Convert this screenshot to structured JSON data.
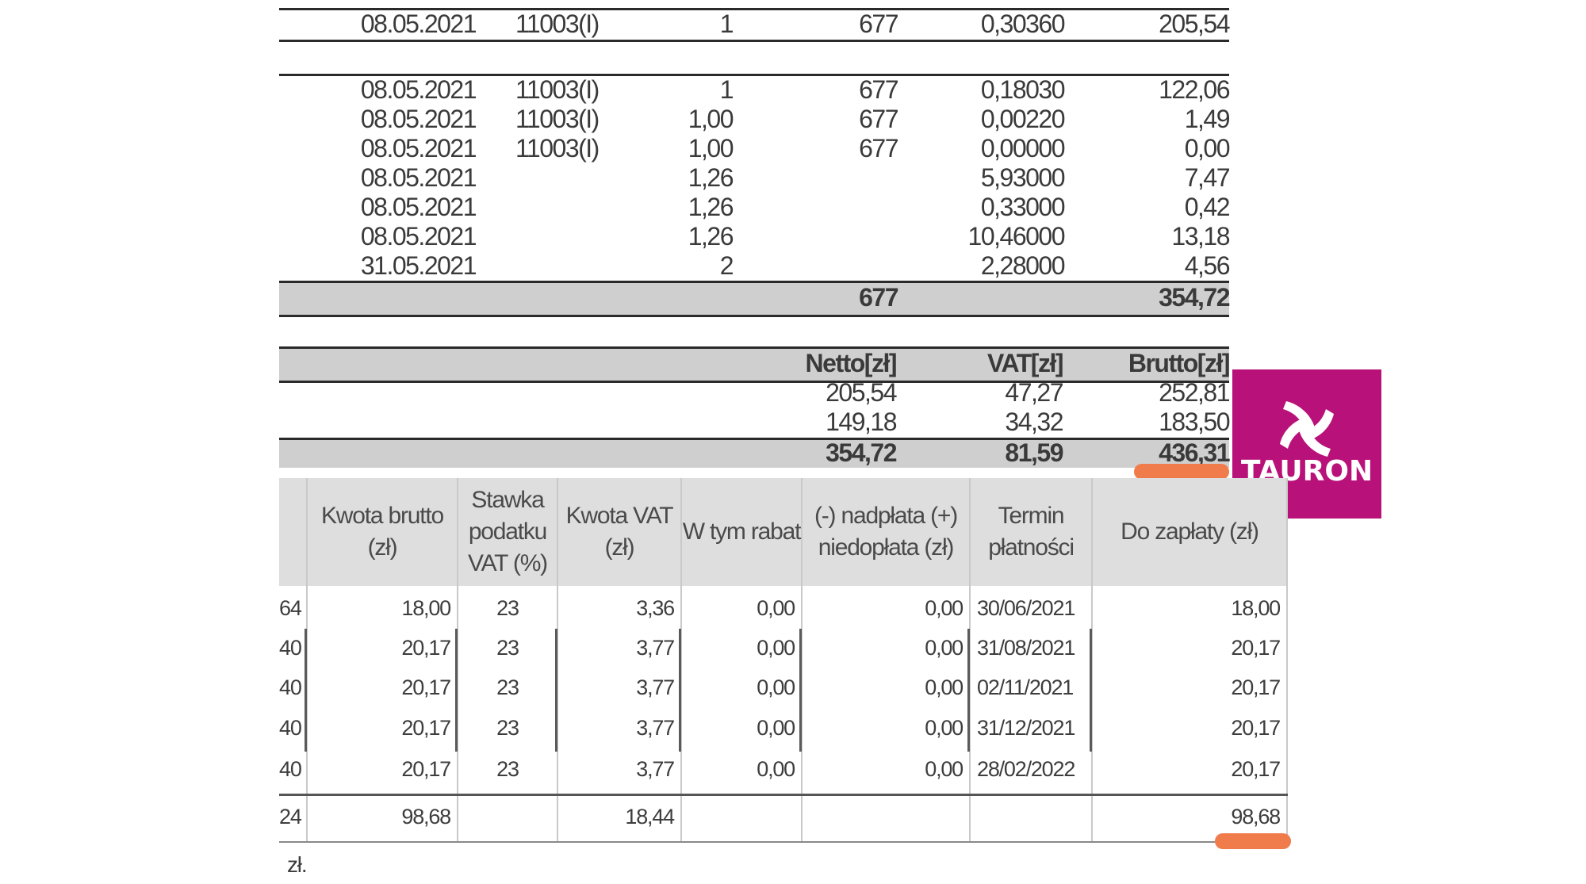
{
  "top_table": {
    "first_row": {
      "date": "08.05.2021",
      "code": "11003(I)",
      "qty": "1",
      "units": "677",
      "price": "0,30360",
      "amount": "205,54"
    },
    "rows": [
      {
        "date": "08.05.2021",
        "code": "11003(I)",
        "qty": "1",
        "units": "677",
        "price": "0,18030",
        "amount": "122,06"
      },
      {
        "date": "08.05.2021",
        "code": "11003(I)",
        "qty": "1,00",
        "units": "677",
        "price": "0,00220",
        "amount": "1,49"
      },
      {
        "date": "08.05.2021",
        "code": "11003(I)",
        "qty": "1,00",
        "units": "677",
        "price": "0,00000",
        "amount": "0,00"
      },
      {
        "date": "08.05.2021",
        "code": "",
        "qty": "1,26",
        "units": "",
        "price": "5,93000",
        "amount": "7,47"
      },
      {
        "date": "08.05.2021",
        "code": "",
        "qty": "1,26",
        "units": "",
        "price": "0,33000",
        "amount": "0,42"
      },
      {
        "date": "08.05.2021",
        "code": "",
        "qty": "1,26",
        "units": "",
        "price": "10,46000",
        "amount": "13,18"
      },
      {
        "date": "31.05.2021",
        "code": "",
        "qty": "2",
        "units": "",
        "price": "2,28000",
        "amount": "4,56"
      }
    ],
    "total_units": "677",
    "total_amount": "354,72"
  },
  "vat_summary": {
    "headers": {
      "netto": "Netto[zł]",
      "vat": "VAT[zł]",
      "brutto": "Brutto[zł]"
    },
    "rows": [
      {
        "netto": "205,54",
        "vat": "47,27",
        "brutto": "252,81"
      },
      {
        "netto": "149,18",
        "vat": "34,32",
        "brutto": "183,50"
      }
    ],
    "total": {
      "netto": "354,72",
      "vat": "81,59",
      "brutto": "436,31"
    }
  },
  "payment_table": {
    "headers": {
      "brutto": "Kwota brutto (zł)",
      "rate": "Stawka podatku VAT (%)",
      "vat": "Kwota VAT (zł)",
      "discount": "W tym rabat",
      "balance": "(-) nadpłata (+) niedopłata (zł)",
      "due": "Termin płatności",
      "to_pay": "Do zapłaty (zł)"
    },
    "rows": [
      {
        "cut": "64",
        "brutto": "18,00",
        "rate": "23",
        "vat": "3,36",
        "discount": "0,00",
        "balance": "0,00",
        "due": "30/06/2021",
        "to_pay": "18,00"
      },
      {
        "cut": "40",
        "brutto": "20,17",
        "rate": "23",
        "vat": "3,77",
        "discount": "0,00",
        "balance": "0,00",
        "due": "31/08/2021",
        "to_pay": "20,17"
      },
      {
        "cut": "40",
        "brutto": "20,17",
        "rate": "23",
        "vat": "3,77",
        "discount": "0,00",
        "balance": "0,00",
        "due": "02/11/2021",
        "to_pay": "20,17"
      },
      {
        "cut": "40",
        "brutto": "20,17",
        "rate": "23",
        "vat": "3,77",
        "discount": "0,00",
        "balance": "0,00",
        "due": "31/12/2021",
        "to_pay": "20,17"
      },
      {
        "cut": "40",
        "brutto": "20,17",
        "rate": "23",
        "vat": "3,77",
        "discount": "0,00",
        "balance": "0,00",
        "due": "28/02/2022",
        "to_pay": "20,17"
      }
    ],
    "total": {
      "cut": "24",
      "brutto": "98,68",
      "vat": "18,44",
      "to_pay": "98,68"
    }
  },
  "footer_text": "zł.",
  "logo": {
    "text": "TAURON",
    "color": "#b8127a"
  },
  "highlight_color": "#f07b4b"
}
